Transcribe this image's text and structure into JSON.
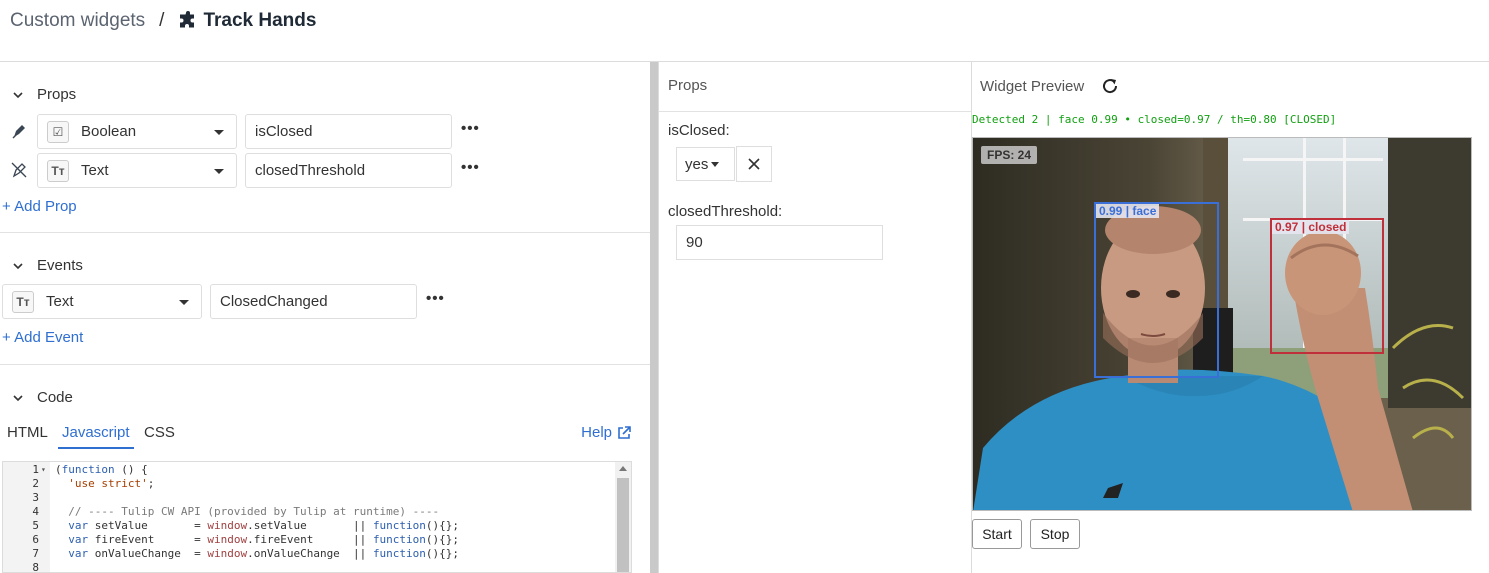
{
  "breadcrumb": {
    "root": "Custom widgets",
    "separator": "/",
    "current": "Track Hands"
  },
  "props_section": {
    "title": "Props",
    "rows": [
      {
        "type": "Boolean",
        "type_glyph": "☑",
        "name": "isClosed",
        "icon": "pen-icon"
      },
      {
        "type": "Text",
        "type_glyph": "Tт",
        "name": "closedThreshold",
        "icon": "pen-off-icon"
      }
    ],
    "add_label": "+ Add Prop"
  },
  "events_section": {
    "title": "Events",
    "rows": [
      {
        "type": "Text",
        "type_glyph": "Tт",
        "name": "ClosedChanged"
      }
    ],
    "add_label": "+ Add Event"
  },
  "code_section": {
    "title": "Code",
    "tabs": [
      "HTML",
      "Javascript",
      "CSS"
    ],
    "active_tab": "Javascript",
    "help_label": "Help",
    "lines": [
      {
        "n": "1",
        "fold": true,
        "html": "(function () {"
      },
      {
        "n": "2",
        "fold": false,
        "html": "  'use strict';"
      },
      {
        "n": "3",
        "fold": false,
        "html": ""
      },
      {
        "n": "4",
        "fold": false,
        "html": "  // ---- Tulip CW API (provided by Tulip at runtime) ----"
      },
      {
        "n": "5",
        "fold": false,
        "html": "  var setValue       = window.setValue       || function(){};"
      },
      {
        "n": "6",
        "fold": false,
        "html": "  var fireEvent      = window.fireEvent      || function(){};"
      },
      {
        "n": "7",
        "fold": false,
        "html": "  var onValueChange  = window.onValueChange  || function(){};"
      },
      {
        "n": "8",
        "fold": false,
        "html": ""
      }
    ]
  },
  "props_panel": {
    "title": "Props",
    "isClosed_label": "isClosed:",
    "isClosed_value": "yes",
    "threshold_label": "closedThreshold:",
    "threshold_value": "90"
  },
  "preview": {
    "title": "Widget Preview",
    "status": "Detected 2 | face 0.99 • closed=0.97 / th=0.80 [CLOSED]",
    "status_color": "#12a012",
    "fps": "FPS: 24",
    "boxes": [
      {
        "label": "0.99 | face",
        "color": "#3b6fd8"
      },
      {
        "label": "0.97 | closed",
        "color": "#c0303a"
      }
    ],
    "start_label": "Start",
    "stop_label": "Stop"
  }
}
